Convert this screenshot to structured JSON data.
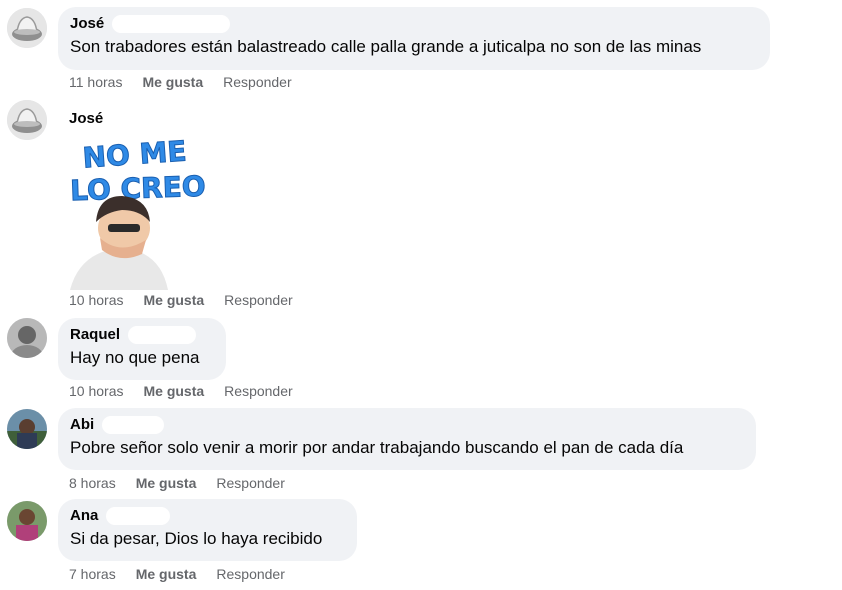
{
  "comments": [
    {
      "author": "José",
      "text": "Son trabadores están balastreado calle palla grande a juticalpa no son de las minas",
      "time": "11 horas",
      "like": "Me gusta",
      "reply": "Responder"
    },
    {
      "author": "José",
      "sticker_text": [
        "NO ME",
        "LO CREO"
      ],
      "time": "10 horas",
      "like": "Me gusta",
      "reply": "Responder"
    },
    {
      "author": "Raquel",
      "text": "Hay no que pena",
      "time": "10 horas",
      "like": "Me gusta",
      "reply": "Responder"
    },
    {
      "author": "Abi",
      "text": "Pobre señor solo venir a morir por andar trabajando buscando el pan de cada día",
      "time": "8 horas",
      "like": "Me gusta",
      "reply": "Responder"
    },
    {
      "author": "Ana",
      "text": "Si da pesar, Dios lo haya recibido",
      "time": "7 horas",
      "like": "Me gusta",
      "reply": "Responder"
    }
  ],
  "colors": {
    "bubble": "#f0f2f5",
    "meta": "#65676b",
    "sticker_text": "#2f8ae6"
  }
}
